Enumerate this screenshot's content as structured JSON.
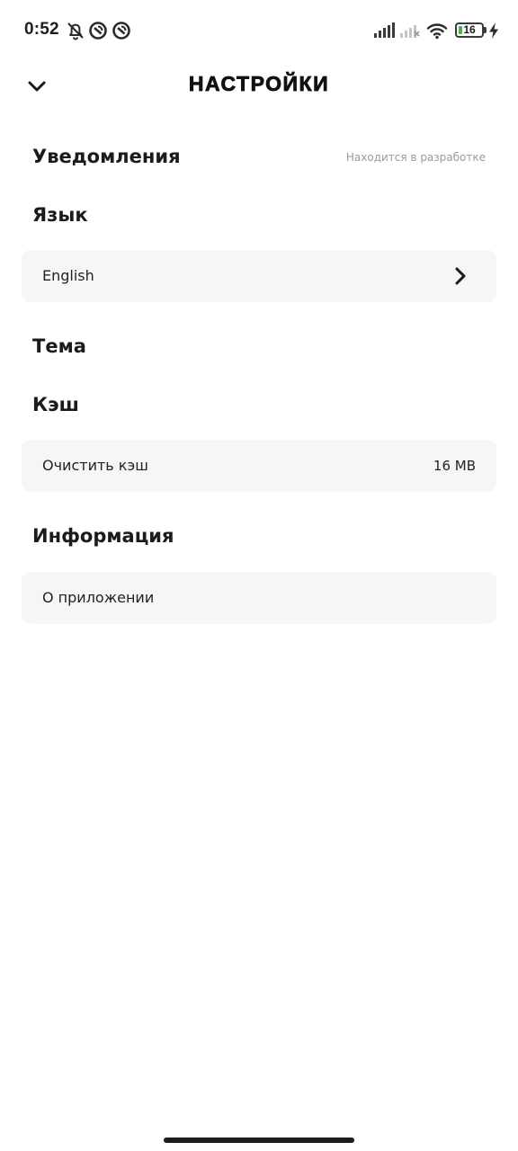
{
  "status_bar": {
    "time": "0:52",
    "battery_level": "16",
    "battery_fraction": 0.16,
    "battery_color": "#4caf50",
    "icons": [
      "bell-off-icon",
      "data-saver-icon",
      "data-saver-icon",
      "cellular-signal-icon",
      "cellular-no-signal-icon",
      "wifi-icon",
      "battery-icon",
      "charging-bolt-icon"
    ]
  },
  "header": {
    "title": "НАСТРОЙКИ",
    "back_icon": "chevron-down-icon"
  },
  "sections": {
    "notifications": {
      "heading": "Уведомления",
      "note": "Находится в разработке"
    },
    "language": {
      "heading": "Язык",
      "value": "English",
      "icon": "chevron-right-icon"
    },
    "theme": {
      "heading": "Тема"
    },
    "cache": {
      "heading": "Кэш",
      "clear_label": "Очистить кэш",
      "size": "16 MB"
    },
    "info": {
      "heading": "Информация",
      "about_label": "О приложении"
    }
  },
  "colors": {
    "card_background": "#f6f6f6",
    "text_primary": "#1b1b1b",
    "text_muted": "#9a9a9a"
  }
}
